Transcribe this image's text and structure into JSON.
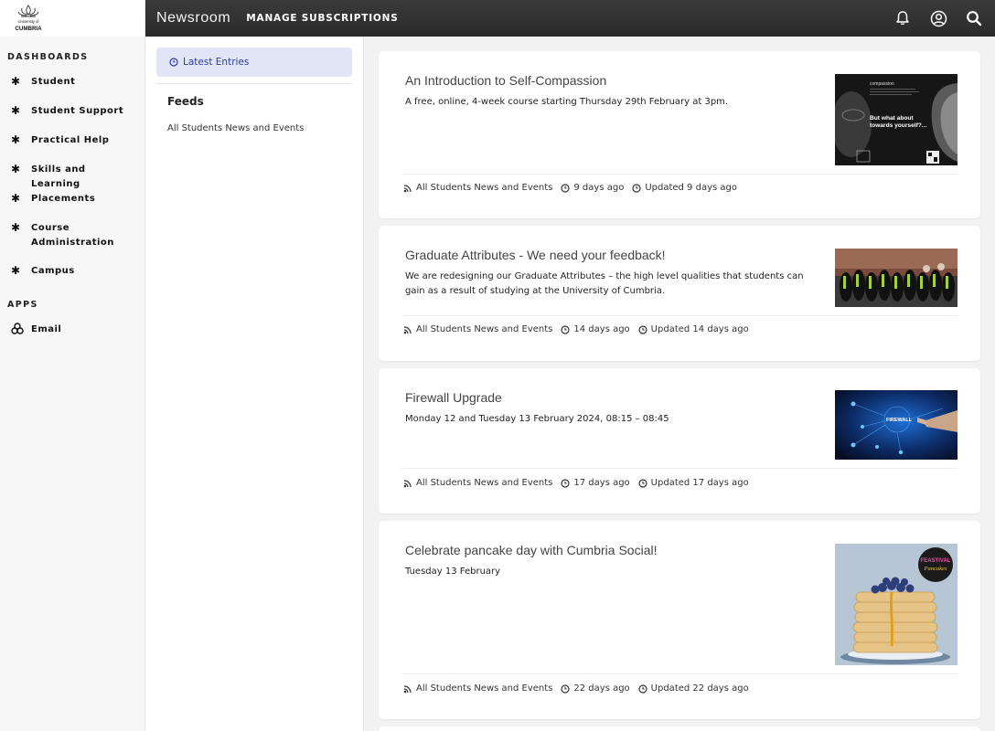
{
  "header": {
    "app_title": "Newsroom",
    "manage_label": "MANAGE SUBSCRIPTIONS",
    "icons": [
      "bell-icon",
      "account-icon",
      "search-icon"
    ]
  },
  "sidebar": {
    "logo_text_top": "University of",
    "logo_text_main": "CUMBRIA",
    "dashboards_label": "DASHBOARDS",
    "items": [
      {
        "label": "Student"
      },
      {
        "label": "Student Support"
      },
      {
        "label": "Practical Help"
      },
      {
        "label": "Skills and Learning"
      },
      {
        "label": "Placements"
      },
      {
        "label": "Course Administration"
      },
      {
        "label": "Campus"
      }
    ],
    "apps_label": "APPS",
    "apps": [
      {
        "label": "Email"
      }
    ]
  },
  "feeds": {
    "latest_label": "Latest Entries",
    "heading": "Feeds",
    "items": [
      "All Students News and Events"
    ]
  },
  "entries": [
    {
      "title": "An Introduction to Self-Compassion",
      "desc": "A free, online, 4-week course starting Thursday 29th February at 3pm.",
      "feed": "All Students News and Events",
      "age": "9 days ago",
      "updated": "Updated 9 days ago",
      "image_text": "But what about towards yourself?...",
      "image_small": "compassion"
    },
    {
      "title": "Graduate Attributes - We need your feedback!",
      "desc": "We are redesigning our Graduate Attributes – the high level qualities that students can gain as a result of studying at the University of Cumbria.",
      "feed": "All Students News and Events",
      "age": "14 days ago",
      "updated": "Updated 14 days ago"
    },
    {
      "title": "Firewall Upgrade",
      "desc": "Monday 12 and Tuesday 13 February 2024, 08:15 – 08:45",
      "feed": "All Students News and Events",
      "age": "17 days ago",
      "updated": "Updated 17 days ago",
      "image_text": "FIREWALL"
    },
    {
      "title": "Celebrate pancake day with Cumbria Social!",
      "desc": "Tuesday 13 February",
      "feed": "All Students News and Events",
      "age": "22 days ago",
      "updated": "Updated 22 days ago",
      "image_text_1": "FEASTIVAL",
      "image_text_2": "Pancakes"
    }
  ]
}
